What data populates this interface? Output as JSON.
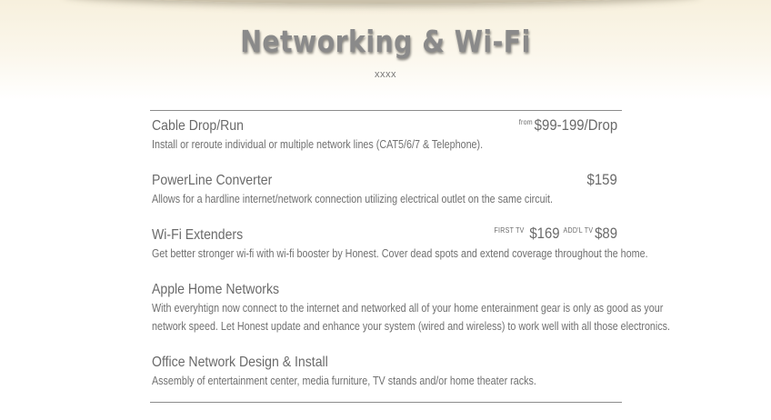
{
  "page": {
    "heading": "Networking & Wi-Fi",
    "subheading": "xxxx"
  },
  "services": [
    {
      "title": "Cable Drop/Run",
      "description": "Install or reroute individual or multiple network lines (CAT5/6/7 & Telephone).",
      "price_prefix": "from",
      "price": "$99-199/Drop"
    },
    {
      "title": "PowerLine Converter",
      "description": "Allows for a hardline internet/network connection utilizing electrical outlet on the same circuit.",
      "price": "$159"
    },
    {
      "title": "Wi-Fi Extenders",
      "description": "Get better stronger wi-fi with wi-fi booster by Honest. Cover dead spots and extend coverage throughout the home.",
      "price_first_label": "FIRST TV",
      "price_first": "$169",
      "price_addl_label": "ADD'L TV",
      "price_addl": "$89"
    },
    {
      "title": "Apple Home Networks",
      "description_line1": "With everyhtign now connect to the internet and networked all of your home enterainment gear is only as good as your",
      "description_line2": "network speed. Let Honest update and enhance your system (wired and wireless) to work well with all those electronics."
    },
    {
      "title": "Office Network Design & Install",
      "description": "Assembly of entertainment center, media furniture, TV stands and/or home theater racks."
    }
  ]
}
